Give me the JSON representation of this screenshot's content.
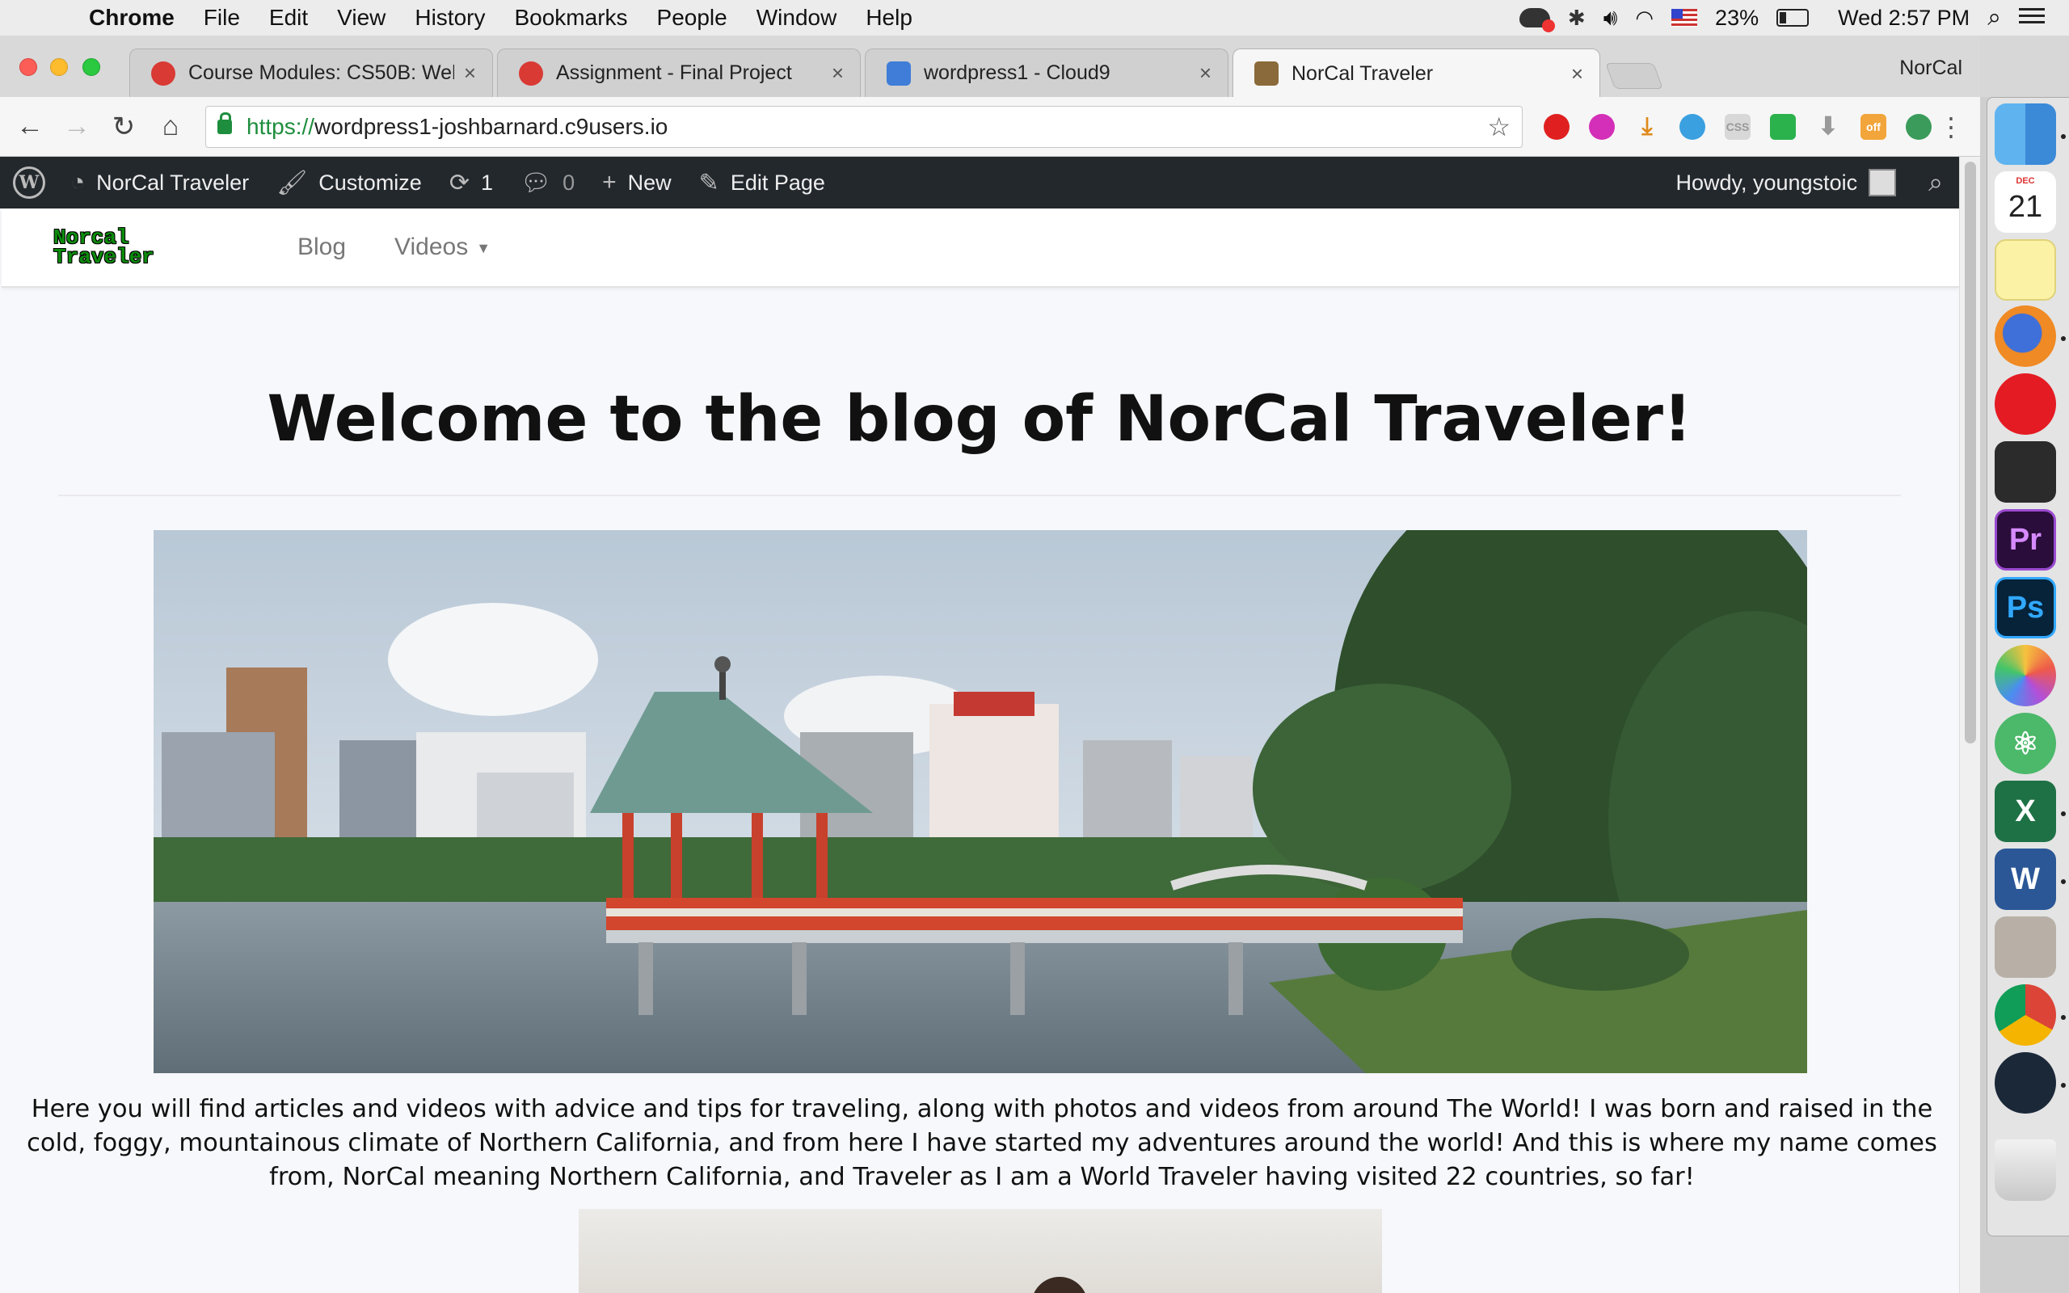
{
  "menubar": {
    "app_name": "Chrome",
    "menus": [
      "File",
      "Edit",
      "View",
      "History",
      "Bookmarks",
      "People",
      "Window",
      "Help"
    ],
    "battery": "23%",
    "clock": "Wed 2:57 PM"
  },
  "tabs": [
    {
      "title": "Course Modules: CS50B: Web",
      "favicon_color": "#d93a34",
      "close": "×"
    },
    {
      "title": "Assignment - Final Project",
      "favicon_color": "#d93a34",
      "close": "×"
    },
    {
      "title": "wordpress1 - Cloud9",
      "favicon_color": "#3f7dd8",
      "close": "×"
    },
    {
      "title": "NorCal Traveler",
      "favicon_color": "#8a6a3a",
      "close": "×",
      "active": true
    }
  ],
  "profile_name": "NorCal",
  "toolbar": {
    "url_scheme": "https://",
    "url_host": "wordpress1-joshbarnard.c9users.io"
  },
  "admin_bar": {
    "site_name": "NorCal Traveler",
    "customize": "Customize",
    "updates_count": "1",
    "comments_count": "0",
    "new_label": "New",
    "edit_page": "Edit Page",
    "howdy": "Howdy, youngstoic"
  },
  "site_nav": {
    "logo_line1": "Norcal",
    "logo_line2": "Traveler",
    "links": [
      "Blog",
      "Videos"
    ]
  },
  "page": {
    "title": "Welcome to the blog of NorCal Traveler!",
    "intro": "Here you will find articles and videos with advice and tips for traveling, along with photos and videos from around The World! I was born and raised in the cold, foggy, mountainous climate of Northern California, and from here I have started my adventures around the world!  And this is where my name comes from, NorCal meaning Northern California, and Traveler as I am a World Traveler having visited 22 countries, so far!"
  },
  "dock": {
    "calendar_month": "DEC",
    "calendar_day": "21"
  },
  "colors": {
    "admin_bar_bg": "#23282d",
    "url_green": "#1e8e3e",
    "logo_green": "#0c8c0c"
  }
}
